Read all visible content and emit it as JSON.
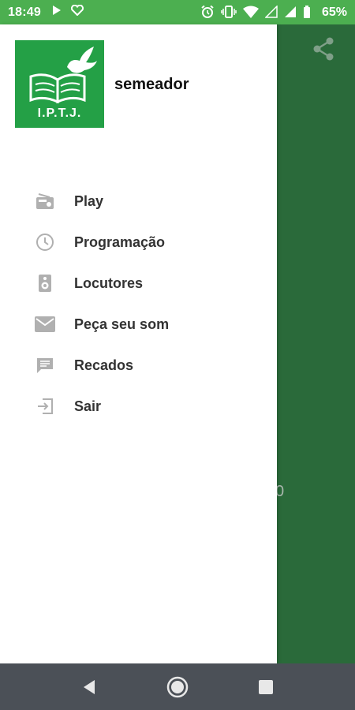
{
  "status_bar": {
    "time": "18:49",
    "battery": "65%"
  },
  "drawer": {
    "logo_text": "I.P.T.J.",
    "app_name": "semeador",
    "menu": [
      {
        "label": "Play",
        "icon": "radio-icon"
      },
      {
        "label": "Programação",
        "icon": "clock-icon"
      },
      {
        "label": "Locutores",
        "icon": "speaker-icon"
      },
      {
        "label": "Peça seu som",
        "icon": "mail-icon"
      },
      {
        "label": "Recados",
        "icon": "message-icon"
      },
      {
        "label": "Sair",
        "icon": "exit-icon"
      }
    ]
  },
  "background_app": {
    "share_icon": "share-icon",
    "partial_text": "0"
  },
  "colors": {
    "status_bar": "#4caf50",
    "logo_green": "#24a046",
    "app_green": "#2a6a3a",
    "nav_bar": "#4b5057",
    "icon_gray": "#b0b0b0"
  }
}
